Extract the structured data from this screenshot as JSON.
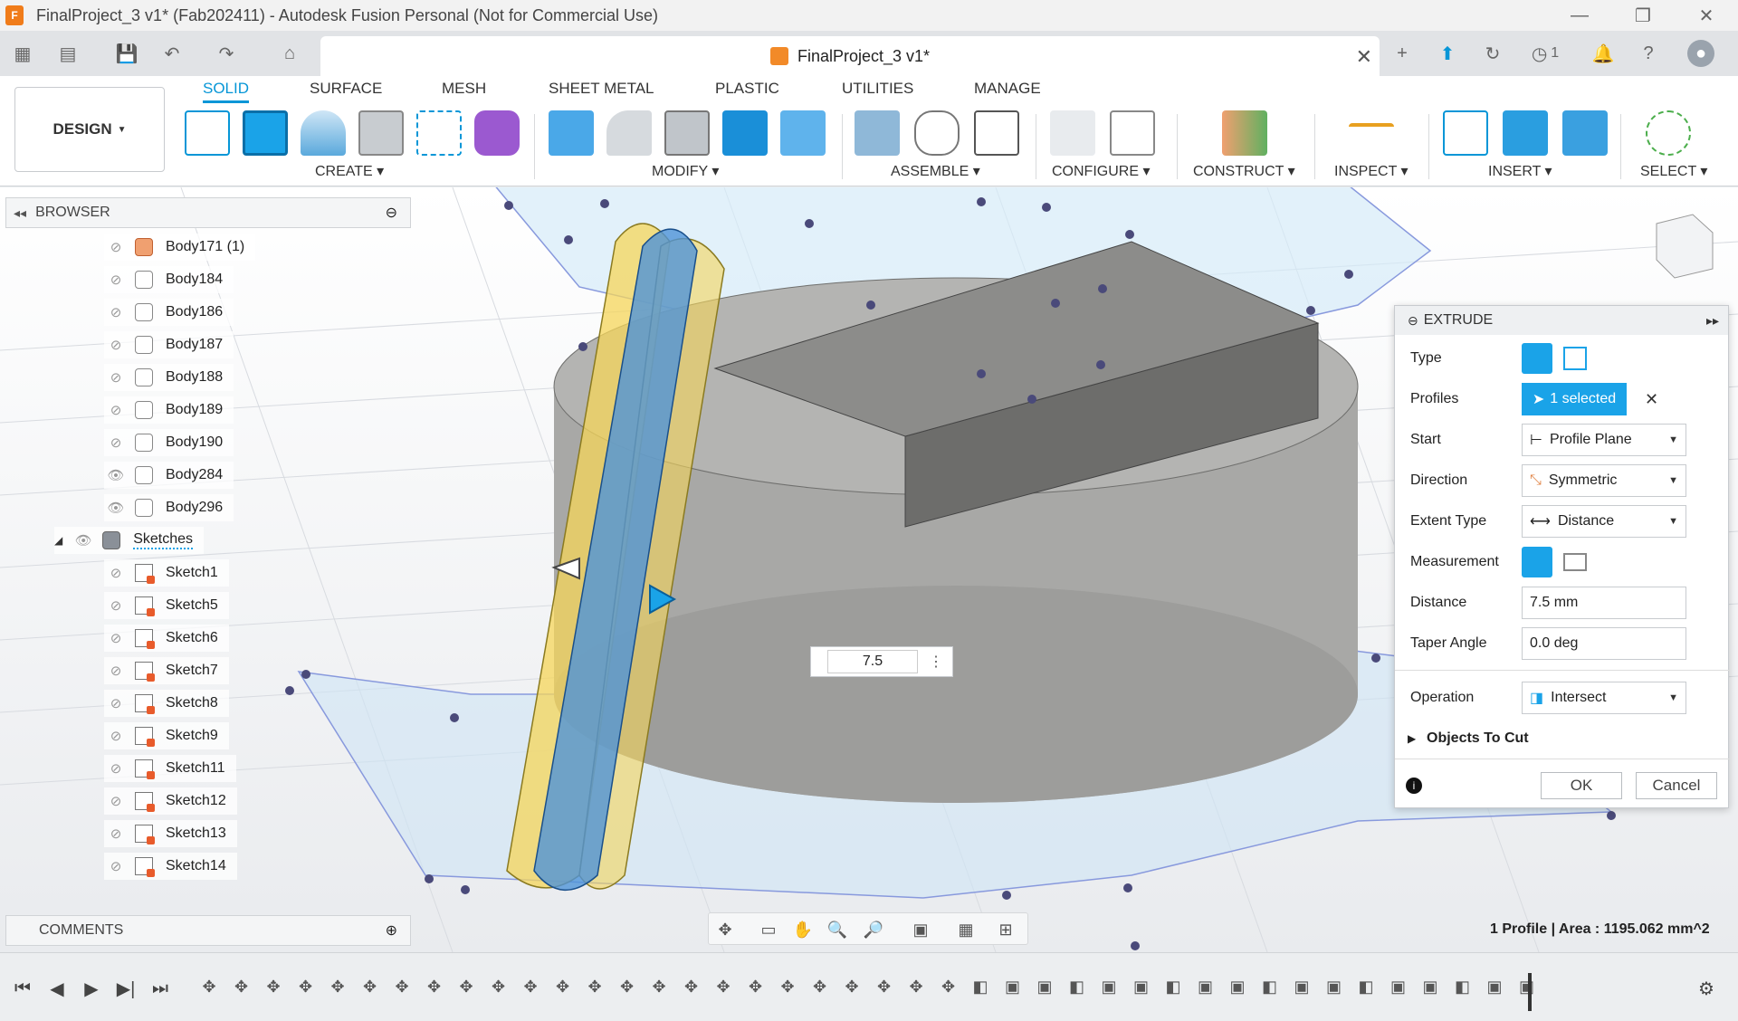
{
  "window": {
    "title": "FinalProject_3 v1* (Fab202411) - Autodesk Fusion Personal (Not for Commercial Use)",
    "logo_letter": "F"
  },
  "tab": {
    "document_name": "FinalProject_3 v1*",
    "job_count": "1"
  },
  "ribbon": {
    "workspace": "DESIGN",
    "tabs": [
      "SOLID",
      "SURFACE",
      "MESH",
      "SHEET METAL",
      "PLASTIC",
      "UTILITIES",
      "MANAGE"
    ],
    "active_tab": "SOLID",
    "groups": [
      "CREATE",
      "MODIFY",
      "ASSEMBLE",
      "CONFIGURE",
      "CONSTRUCT",
      "INSPECT",
      "INSERT",
      "SELECT"
    ]
  },
  "browser": {
    "title": "BROWSER",
    "items": [
      {
        "label": "Body171 (1)",
        "type": "body",
        "visible": false,
        "color": "orange"
      },
      {
        "label": "Body184",
        "type": "body",
        "visible": false
      },
      {
        "label": "Body186",
        "type": "body",
        "visible": false
      },
      {
        "label": "Body187",
        "type": "body",
        "visible": false
      },
      {
        "label": "Body188",
        "type": "body",
        "visible": false
      },
      {
        "label": "Body189",
        "type": "body",
        "visible": false
      },
      {
        "label": "Body190",
        "type": "body",
        "visible": false
      },
      {
        "label": "Body284",
        "type": "body",
        "visible": true
      },
      {
        "label": "Body296",
        "type": "body",
        "visible": true
      },
      {
        "label": "Sketches",
        "type": "folder",
        "visible": true
      },
      {
        "label": "Sketch1",
        "type": "sketch",
        "visible": false
      },
      {
        "label": "Sketch5",
        "type": "sketch",
        "visible": false
      },
      {
        "label": "Sketch6",
        "type": "sketch",
        "visible": false
      },
      {
        "label": "Sketch7",
        "type": "sketch",
        "visible": false
      },
      {
        "label": "Sketch8",
        "type": "sketch",
        "visible": false
      },
      {
        "label": "Sketch9",
        "type": "sketch",
        "visible": false
      },
      {
        "label": "Sketch11",
        "type": "sketch",
        "visible": false
      },
      {
        "label": "Sketch12",
        "type": "sketch",
        "visible": false
      },
      {
        "label": "Sketch13",
        "type": "sketch",
        "visible": false
      },
      {
        "label": "Sketch14",
        "type": "sketch",
        "visible": false
      }
    ]
  },
  "comments": {
    "title": "COMMENTS"
  },
  "canvas": {
    "dimension_value": "7.5",
    "status": "1 Profile | Area : 1195.062 mm^2"
  },
  "extrude": {
    "title": "EXTRUDE",
    "type_label": "Type",
    "profiles_label": "Profiles",
    "profiles_value": "1 selected",
    "start_label": "Start",
    "start_value": "Profile Plane",
    "direction_label": "Direction",
    "direction_value": "Symmetric",
    "extent_label": "Extent Type",
    "extent_value": "Distance",
    "measurement_label": "Measurement",
    "distance_label": "Distance",
    "distance_value": "7.5 mm",
    "taper_label": "Taper Angle",
    "taper_value": "0.0 deg",
    "operation_label": "Operation",
    "operation_value": "Intersect",
    "objects_to_cut": "Objects To Cut",
    "ok": "OK",
    "cancel": "Cancel"
  },
  "colors": {
    "accent": "#0696d7",
    "selection_blue": "#1aa3e8",
    "sketch_yellow": "#f5d65a"
  }
}
